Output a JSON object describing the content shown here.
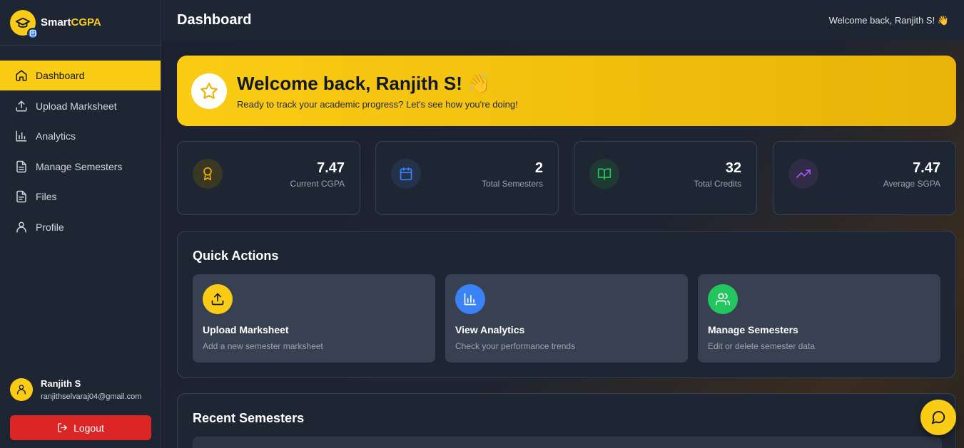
{
  "brand": {
    "name_main": "Smart",
    "name_accent": "CGPA",
    "accent_color": "#facc15"
  },
  "sidebar": {
    "items": [
      {
        "label": "Dashboard",
        "icon": "home-icon",
        "active": true
      },
      {
        "label": "Upload Marksheet",
        "icon": "upload-icon"
      },
      {
        "label": "Analytics",
        "icon": "bar-chart-icon"
      },
      {
        "label": "Manage Semesters",
        "icon": "document-icon"
      },
      {
        "label": "Files",
        "icon": "file-icon"
      },
      {
        "label": "Profile",
        "icon": "user-icon"
      }
    ],
    "user": {
      "name": "Ranjith S",
      "email": "ranjithselvaraj04@gmail.com"
    },
    "logout_label": "Logout"
  },
  "header": {
    "title": "Dashboard",
    "welcome": "Welcome back, Ranjith S! 👋"
  },
  "hero": {
    "title": "Welcome back, Ranjith S! 👋",
    "subtitle": "Ready to track your academic progress? Let's see how you're doing!"
  },
  "stats": [
    {
      "value": "7.47",
      "label": "Current CGPA",
      "icon": "award-icon",
      "color": "#eab308"
    },
    {
      "value": "2",
      "label": "Total Semesters",
      "icon": "calendar-icon",
      "color": "#3b82f6"
    },
    {
      "value": "32",
      "label": "Total Credits",
      "icon": "book-icon",
      "color": "#22c55e"
    },
    {
      "value": "7.47",
      "label": "Average SGPA",
      "icon": "trending-up-icon",
      "color": "#a855f7"
    }
  ],
  "quick_actions": {
    "title": "Quick Actions",
    "items": [
      {
        "title": "Upload Marksheet",
        "desc": "Add a new semester marksheet",
        "icon": "upload-icon",
        "color": "#facc15"
      },
      {
        "title": "View Analytics",
        "desc": "Check your performance trends",
        "icon": "bar-chart-icon",
        "color": "#3b82f6"
      },
      {
        "title": "Manage Semesters",
        "desc": "Edit or delete semester data",
        "icon": "users-icon",
        "color": "#22c55e"
      }
    ]
  },
  "recent": {
    "title": "Recent Semesters"
  }
}
